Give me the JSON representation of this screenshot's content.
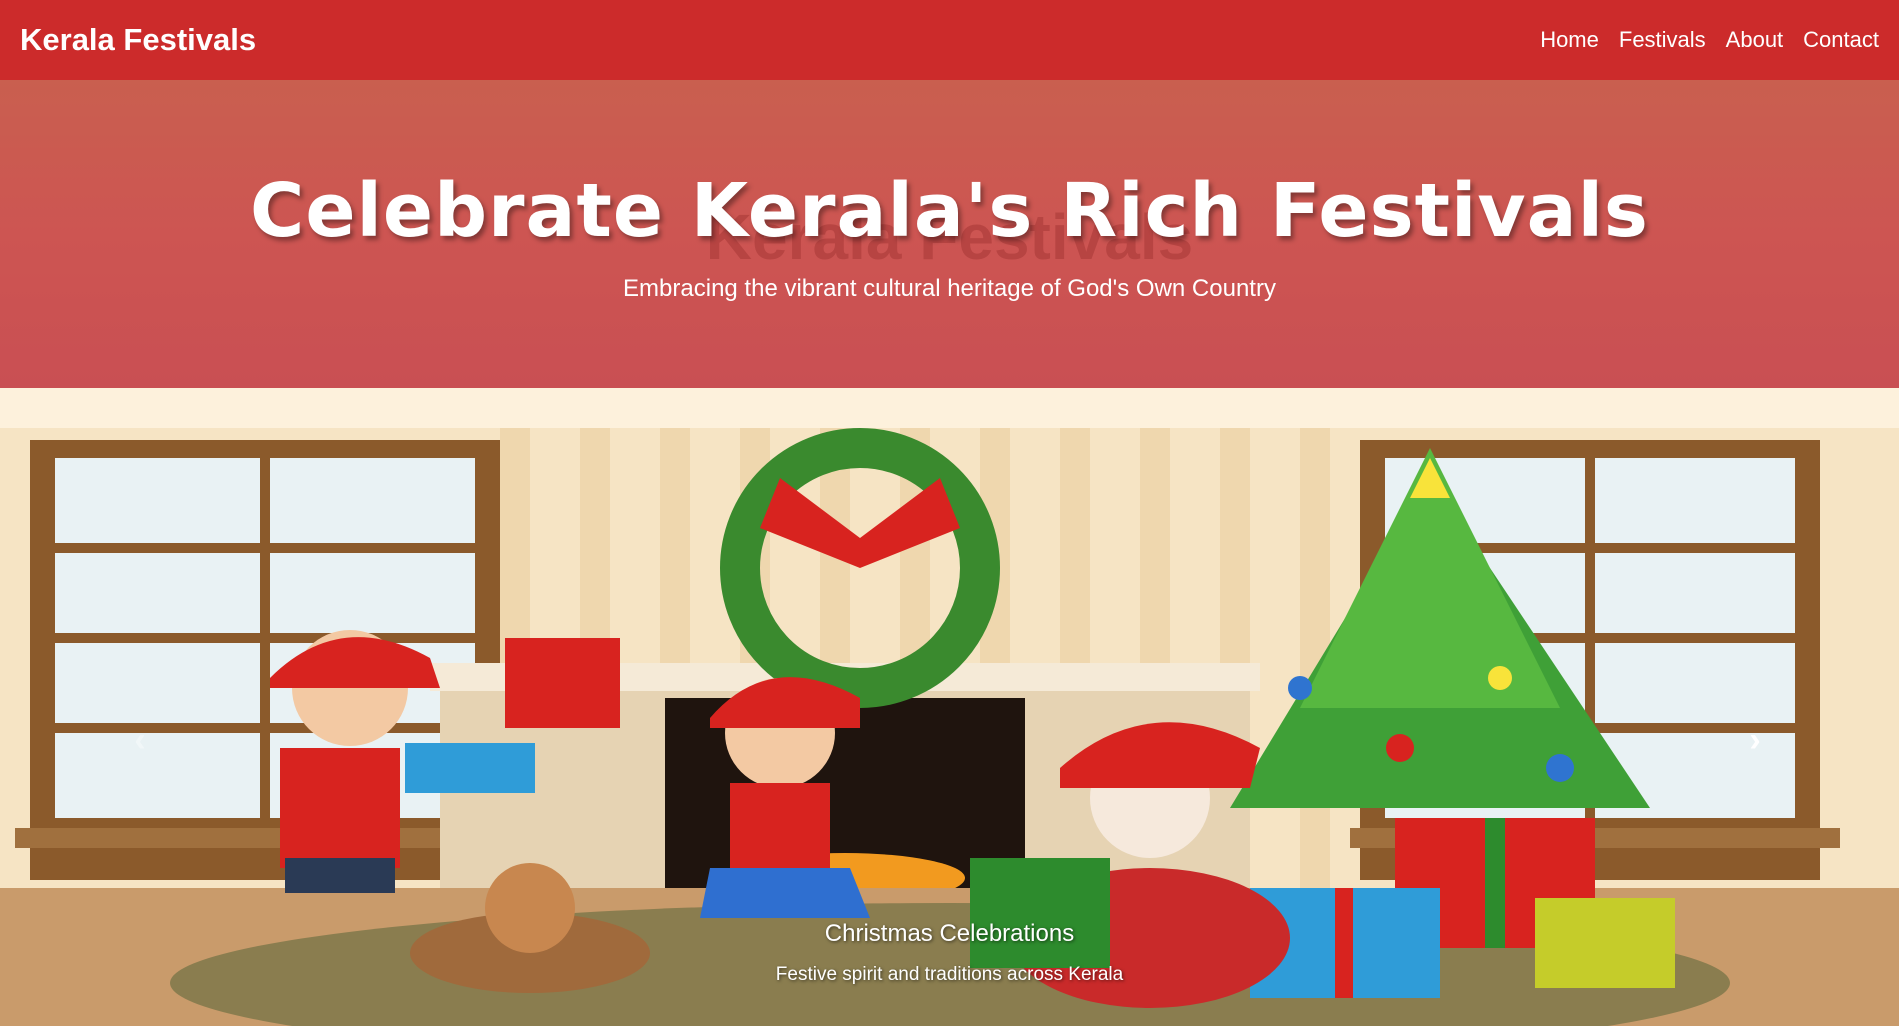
{
  "nav": {
    "brand": "Kerala Festivals",
    "links": [
      "Home",
      "Festivals",
      "About",
      "Contact"
    ]
  },
  "hero": {
    "title": "Celebrate Kerala's Rich Festivals",
    "watermark": "Kerala Festivals",
    "subtitle": "Embracing the vibrant cultural heritage of God's Own Country"
  },
  "carousel": {
    "slide_title": "Christmas Celebrations",
    "slide_text": "Festive spirit and traditions across Kerala",
    "prev_icon": "‹",
    "next_icon": "›"
  },
  "colors": {
    "navbar": "#cc2b2b",
    "hero": "#cd5552"
  }
}
